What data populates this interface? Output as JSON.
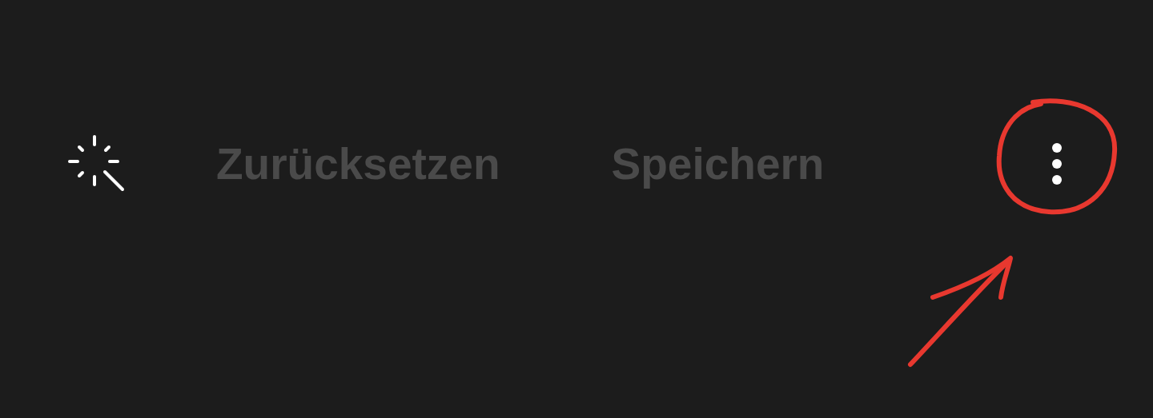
{
  "toolbar": {
    "actions": [
      {
        "label": "Zurücksetzen",
        "disabled": true
      },
      {
        "label": "Speichern",
        "disabled": true
      }
    ]
  }
}
